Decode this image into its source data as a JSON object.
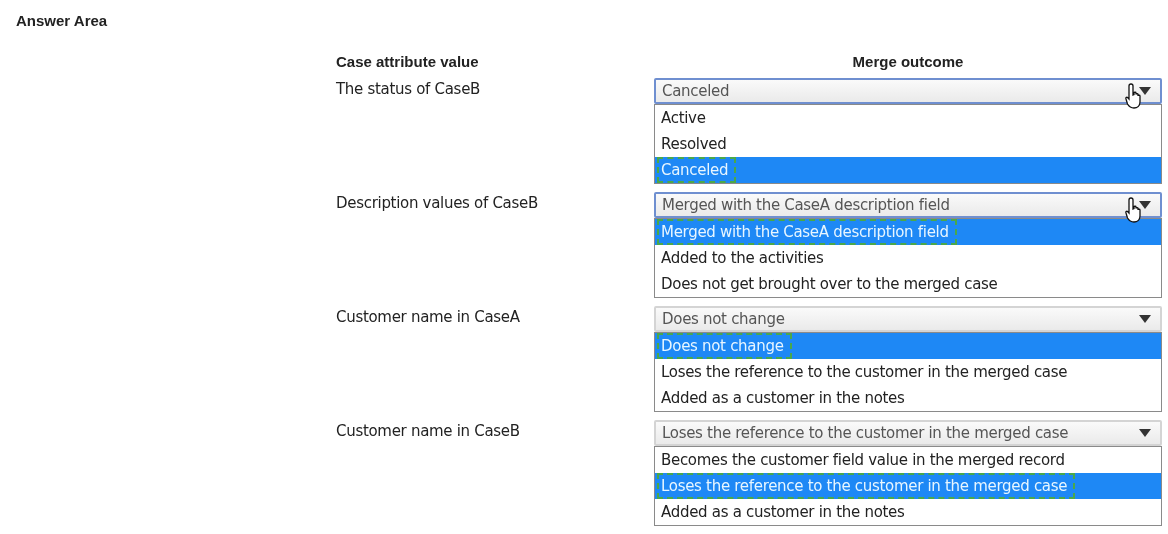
{
  "title": "Answer Area",
  "columns": [
    "Case attribute value",
    "Merge outcome"
  ],
  "rows": [
    {
      "label": "The status of CaseB",
      "value": "Canceled",
      "focused": true,
      "options": [
        {
          "label": "Active",
          "selected": false
        },
        {
          "label": "Resolved",
          "selected": false
        },
        {
          "label": "Canceled",
          "selected": true
        }
      ]
    },
    {
      "label": "Description values of CaseB",
      "value": "Merged with the CaseA description field",
      "focused": true,
      "options": [
        {
          "label": "Merged with the CaseA description field",
          "selected": true
        },
        {
          "label": "Added to the activities",
          "selected": false
        },
        {
          "label": "Does not get brought over to the merged case",
          "selected": false
        }
      ]
    },
    {
      "label": "Customer name in CaseA",
      "value": "Does not change",
      "focused": false,
      "options": [
        {
          "label": "Does not change",
          "selected": true
        },
        {
          "label": "Loses the reference to the customer in the merged case",
          "selected": false
        },
        {
          "label": "Added as a customer in the notes",
          "selected": false
        }
      ]
    },
    {
      "label": "Customer name in CaseB",
      "value": "Loses the reference to the customer in the merged case",
      "focused": false,
      "options": [
        {
          "label": "Becomes the customer field value in the merged record",
          "selected": false
        },
        {
          "label": "Loses the reference to the customer in the merged case",
          "selected": true
        },
        {
          "label": "Added as a customer in the notes",
          "selected": false
        }
      ]
    }
  ]
}
